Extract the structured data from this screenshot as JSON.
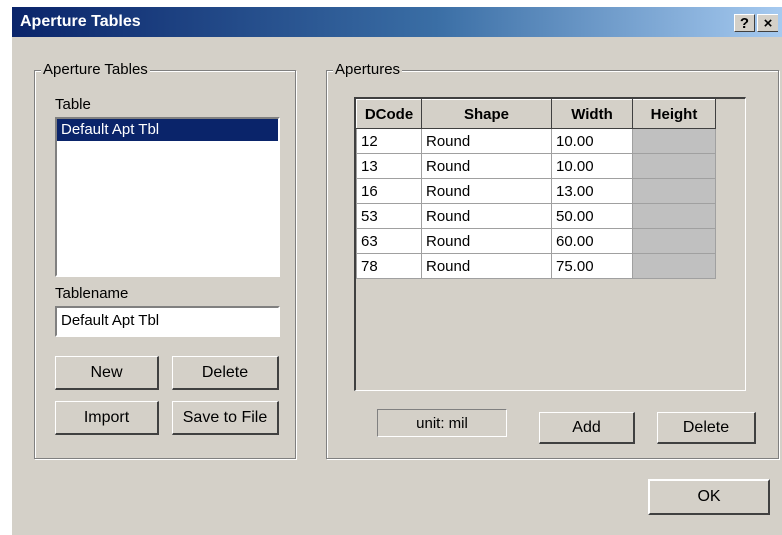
{
  "window": {
    "title": "Aperture Tables",
    "help_glyph": "?",
    "close_glyph": "×"
  },
  "left_group": {
    "legend": "Aperture Tables",
    "table_label": "Table",
    "table_items": [
      "Default Apt Tbl"
    ],
    "selected_item": "Default Apt Tbl",
    "tablename_label": "Tablename",
    "tablename_value": "Default Apt Tbl",
    "new_label": "New",
    "delete_label": "Delete",
    "import_label": "Import",
    "save_label": "Save to File"
  },
  "right_group": {
    "legend": "Apertures",
    "columns": [
      "DCode",
      "Shape",
      "Width",
      "Height"
    ],
    "rows": [
      {
        "dcode": "12",
        "shape": "Round",
        "width": "10.00",
        "height": ""
      },
      {
        "dcode": "13",
        "shape": "Round",
        "width": "10.00",
        "height": ""
      },
      {
        "dcode": "16",
        "shape": "Round",
        "width": "13.00",
        "height": ""
      },
      {
        "dcode": "53",
        "shape": "Round",
        "width": "50.00",
        "height": ""
      },
      {
        "dcode": "63",
        "shape": "Round",
        "width": "60.00",
        "height": ""
      },
      {
        "dcode": "78",
        "shape": "Round",
        "width": "75.00",
        "height": ""
      }
    ],
    "unit_text": "unit: mil",
    "add_label": "Add",
    "delete_label": "Delete"
  },
  "ok_label": "OK",
  "colors": {
    "title_start": "#0a246a",
    "title_end": "#a6caf0",
    "face": "#d4d0c8",
    "selection": "#0a246a",
    "disabled_cell": "#c0c0c0"
  }
}
